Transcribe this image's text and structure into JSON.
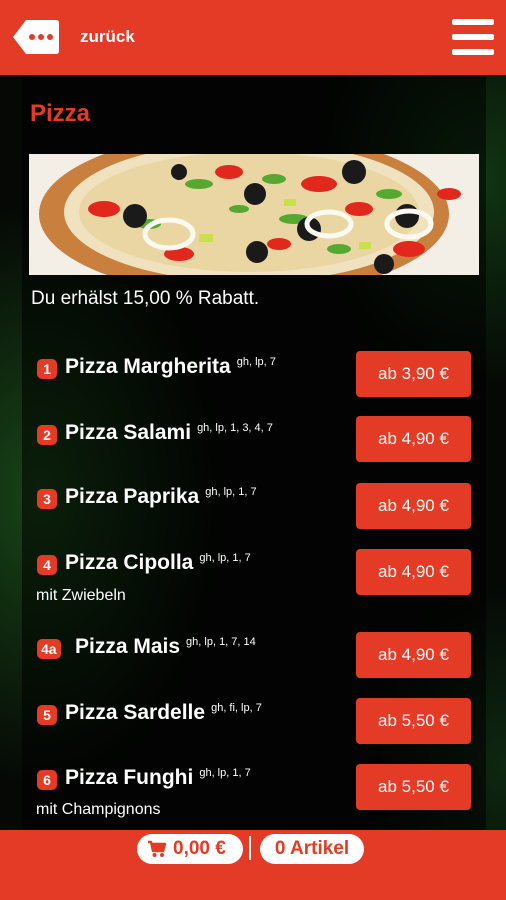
{
  "header": {
    "back_label": "zurück",
    "back_icon": "more-dots-tag-icon",
    "menu_icon": "hamburger-menu-icon"
  },
  "category": {
    "title": "Pizza",
    "discount_text": "Du erhälst 15,00 % Rabatt."
  },
  "items": [
    {
      "number": "1",
      "name": "Pizza Margherita",
      "allergens": "gh, lp, 7",
      "description": "",
      "price": "ab 3,90 €"
    },
    {
      "number": "2",
      "name": "Pizza Salami",
      "allergens": "gh, lp, 1, 3, 4, 7",
      "description": "",
      "price": "ab 4,90 €"
    },
    {
      "number": "3",
      "name": "Pizza Paprika",
      "allergens": "gh, lp, 1, 7",
      "description": "",
      "price": "ab 4,90 €"
    },
    {
      "number": "4",
      "name": "Pizza Cipolla",
      "allergens": "gh, lp, 1, 7",
      "description": "mit Zwiebeln",
      "price": "ab 4,90 €"
    },
    {
      "number": "4a",
      "name": "Pizza Mais",
      "allergens": "gh, lp, 1, 7, 14",
      "description": "",
      "price": "ab 4,90 €"
    },
    {
      "number": "5",
      "name": "Pizza Sardelle",
      "allergens": "gh, fi, lp, 7",
      "description": "",
      "price": "ab 5,50 €"
    },
    {
      "number": "6",
      "name": "Pizza Funghi",
      "allergens": "gh, lp, 1, 7",
      "description": "mit Champignons",
      "price": "ab 5,50 €"
    }
  ],
  "footer": {
    "cart_icon": "shopping-cart-icon",
    "cart_total": "0,00 €",
    "item_count": "0 Artikel"
  },
  "colors": {
    "accent": "#e33b25",
    "background": "#050805"
  }
}
